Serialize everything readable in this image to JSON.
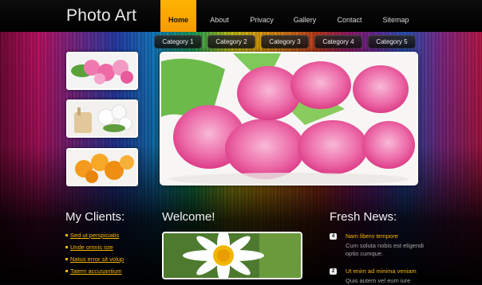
{
  "site": {
    "logo": "Photo Art"
  },
  "nav": [
    {
      "label": "Home",
      "active": true
    },
    {
      "label": "About"
    },
    {
      "label": "Privacy"
    },
    {
      "label": "Gallery"
    },
    {
      "label": "Contact"
    },
    {
      "label": "Sitemap"
    }
  ],
  "categories": [
    "Category 1",
    "Category 2",
    "Category 3",
    "Category 4",
    "Category 5"
  ],
  "clients": {
    "heading": "My Clients:",
    "links": [
      "Sed ut perspiciatis",
      "Unde omnis iste",
      "Natus error sit volup",
      "Tatem accusantium"
    ]
  },
  "welcome": {
    "heading": "Welcome!"
  },
  "news": {
    "heading": "Fresh News:",
    "items": [
      {
        "num": "4",
        "title": "Nam libero tempore",
        "text": "Cum soluta nobis est eligendi optio cumque."
      },
      {
        "num": "2",
        "title": "Ut enim ad minima veniam",
        "text": "Quis autem vel eum iure"
      }
    ]
  },
  "colors": {
    "accent": "#f5a800",
    "link": "#f5b800"
  }
}
